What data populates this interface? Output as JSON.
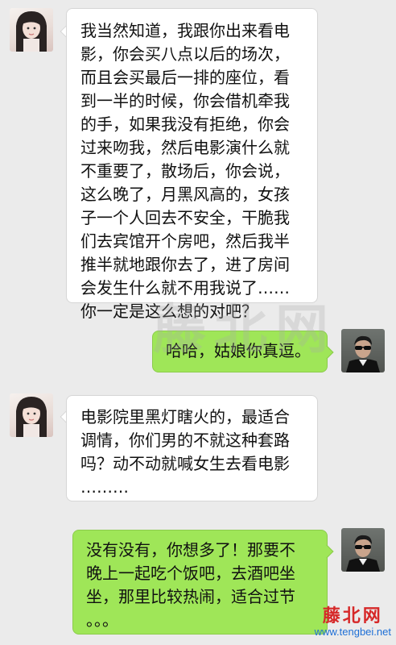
{
  "messages": [
    {
      "sender": "girl",
      "text": "我当然知道，我跟你出来看电\n影，你会买八点以后的场次，\n而且会买最后一排的座位，看\n到一半的时候，你会借机牵我\n的手，如果我没有拒绝，你会\n过来吻我，然后电影演什么就\n不重要了，散场后，你会说，\n这么晚了，月黑风高的，女孩\n子一个人回去不安全，干脆我\n们去宾馆开个房吧，然后我半\n推半就地跟你去了，进了房间\n会发生什么就不用我说了……\n你一定是这么想的对吧？"
    },
    {
      "sender": "boy",
      "text": "哈哈，姑娘你真逗。"
    },
    {
      "sender": "girl",
      "text": "电影院里黑灯瞎火的，最适合\n调情，你们男的不就这种套路\n吗？动不动就喊女生去看电影\n………"
    },
    {
      "sender": "boy",
      "text": "没有没有，你想多了！那要不\n晚上一起吃个饭吧，去酒吧坐\n坐，那里比较热闹，适合过节\n。。。"
    }
  ],
  "avatars": {
    "girl": "girl-avatar",
    "boy": "man-in-sunglasses-avatar"
  },
  "watermark": {
    "text": "藤北网",
    "logo_name": "藤北网",
    "logo_url": "www.tengbei.net"
  },
  "colors": {
    "background": "#ebebeb",
    "incoming_bubble": "#ffffff",
    "outgoing_bubble": "#9fe658",
    "logo_red": "#d62828",
    "logo_blue": "#1d6fd6"
  }
}
